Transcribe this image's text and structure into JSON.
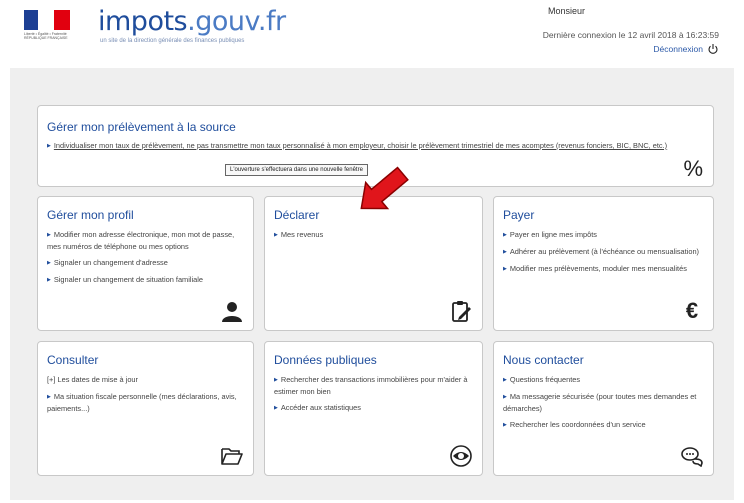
{
  "header": {
    "brand_part1": "impots",
    "brand_part2": ".gouv.fr",
    "tagline": "un site de la direction générale des finances publiques",
    "rf_text": "Liberté • Égalité • Fraternité RÉPUBLIQUE FRANÇAISE",
    "user_name": "Monsieur",
    "last_connection": "Dernière connexion le 12 avril 2018 à 16:23:59",
    "logout_label": "Déconnexion"
  },
  "prelevement": {
    "title": "Gérer mon prélèvement à la source",
    "link_text": "Individualiser mon taux de prélèvement, ne pas transmettre mon taux personnalisé à mon employeur, choisir le prélèvement trimestriel de mes acomptes (revenus fonciers, BIC, BNC, etc.)",
    "tooltip": "L'ouverture s'effectuera dans une nouvelle fenêtre",
    "icon_glyph": "%"
  },
  "tiles": {
    "profil": {
      "title": "Gérer mon profil",
      "items": [
        "Modifier mon adresse électronique, mon mot de passe, mes numéros de téléphone ou mes options",
        "Signaler un changement d'adresse",
        "Signaler un changement de situation familiale"
      ]
    },
    "declarer": {
      "title": "Déclarer",
      "items": [
        "Mes revenus"
      ]
    },
    "payer": {
      "title": "Payer",
      "items": [
        "Payer en ligne mes impôts",
        "Adhérer au prélèvement (à l'échéance ou mensualisation)",
        "Modifier mes prélèvements, moduler mes mensualités"
      ],
      "icon_glyph": "€"
    },
    "consulter": {
      "title": "Consulter",
      "items": [
        "[+] Les dates de mise à jour",
        "Ma situation fiscale personnelle (mes déclarations, avis, paiements...)"
      ]
    },
    "donnees": {
      "title": "Données publiques",
      "items": [
        "Rechercher des transactions immobilières pour m'aider à estimer mon bien",
        "Accéder aux statistiques"
      ]
    },
    "contact": {
      "title": "Nous contacter",
      "items": [
        "Questions fréquentes",
        "Ma messagerie sécurisée (pour toutes mes demandes et démarches)",
        "Rechercher les coordonnées d'un service"
      ]
    }
  },
  "colors": {
    "brand_blue": "#1f4d9c",
    "flag_blue": "#1d3f94",
    "flag_red": "#e1000f",
    "arrow_red": "#e0151b",
    "panel_gray": "#efefef"
  }
}
